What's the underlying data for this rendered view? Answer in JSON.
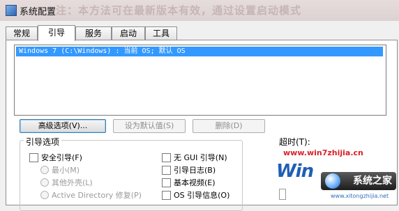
{
  "window": {
    "title": "系统配置",
    "overlay_text": "注：本方法可在最新版本有效，通过设置启动模式"
  },
  "tabs": [
    {
      "label": "常规"
    },
    {
      "label": "引导"
    },
    {
      "label": "服务"
    },
    {
      "label": "启动"
    },
    {
      "label": "工具"
    }
  ],
  "active_tab": "引导",
  "os_list": {
    "items": [
      "Windows 7 (C:\\Windows) : 当前 OS; 默认 OS"
    ],
    "selected_index": 0
  },
  "buttons": {
    "advanced": "高级选项(V)...",
    "set_default": "设为默认值(S)",
    "delete": "删除(D)"
  },
  "boot_options": {
    "label": "引导选项",
    "safe_boot": "安全引导(F)",
    "minimal": "最小(M)",
    "alternate_shell": "其他外壳(L)",
    "active_directory_repair": "Active Directory 修复(P)",
    "no_gui_boot": "无 GUI 引导(N)",
    "boot_log": "引导日志(B)",
    "base_video": "基本视频(E)",
    "os_boot_info": "OS 引导信息(O)"
  },
  "timeout": {
    "label": "超时(T):"
  },
  "watermark": {
    "url": "www.win7zhijia.cn",
    "logo_win": "Win",
    "logo_brand": "系统之家",
    "logo_small": "www.xitongzhijia.net"
  },
  "colors": {
    "selection": "#3399ff",
    "watermark_red": "#d9202a",
    "brand_blue": "#1f5fb5"
  }
}
